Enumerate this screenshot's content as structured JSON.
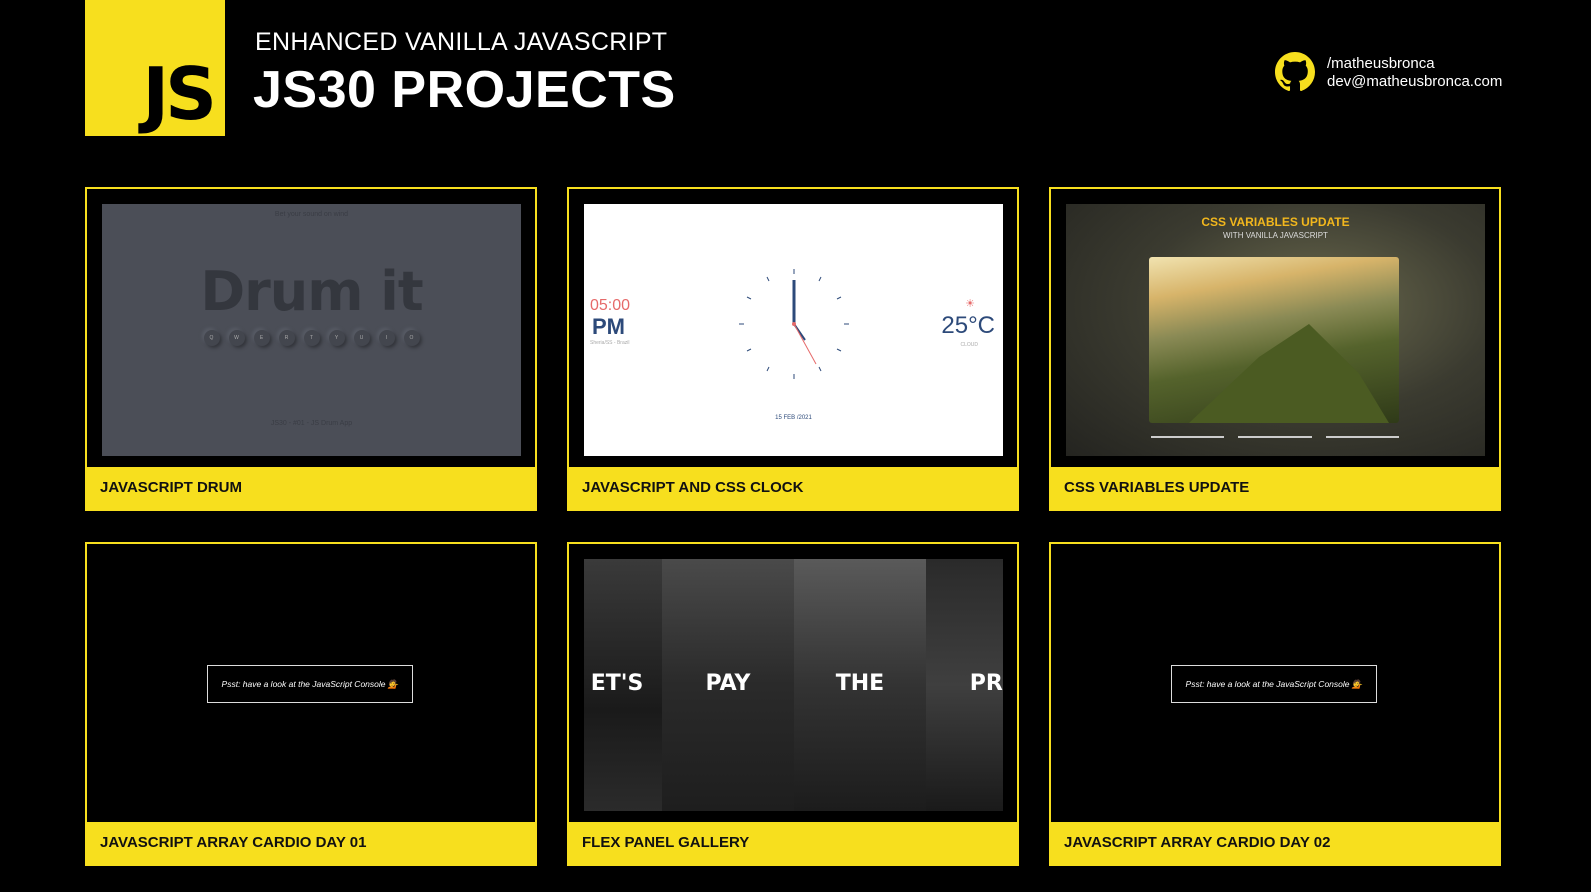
{
  "header": {
    "logo_text": "JS",
    "kicker": "ENHANCED VANILLA JAVASCRIPT",
    "title": "JS30 PROJECTS",
    "github": "/matheusbronca",
    "email": "dev@matheusbronca.com"
  },
  "colors": {
    "accent": "#f7df1e",
    "background": "#000000"
  },
  "projects": [
    {
      "label": "JAVASCRIPT DRUM",
      "preview": {
        "top_text": "Bet your sound on wind",
        "heading": "Drum it",
        "keys": [
          "Q",
          "W",
          "E",
          "R",
          "T",
          "Y",
          "U",
          "I",
          "O"
        ],
        "footer": "JS30 - #01 - JS Drum App"
      }
    },
    {
      "label": "JAVASCRIPT AND CSS CLOCK",
      "preview": {
        "time": "05:00",
        "period": "PM",
        "location": "Sheria/SS - Brazil",
        "temperature": "25°C",
        "weather": "CLOUD",
        "date": "15 FEB /2021"
      }
    },
    {
      "label": "CSS VARIABLES UPDATE",
      "preview": {
        "heading": "CSS VARIABLES UPDATE",
        "subheading": "WITH VANILLA JAVASCRIPT"
      }
    },
    {
      "label": "JAVASCRIPT ARRAY CARDIO DAY 01",
      "preview": {
        "message": "Psst: have a look at the JavaScript Console 💁"
      }
    },
    {
      "label": "FLEX PANEL GALLERY",
      "preview": {
        "words": [
          "ET'S",
          "PAY",
          "THE",
          "PRIC"
        ]
      }
    },
    {
      "label": "JAVASCRIPT ARRAY CARDIO DAY 02",
      "preview": {
        "message": "Psst: have a look at the JavaScript Console 💁"
      }
    }
  ]
}
